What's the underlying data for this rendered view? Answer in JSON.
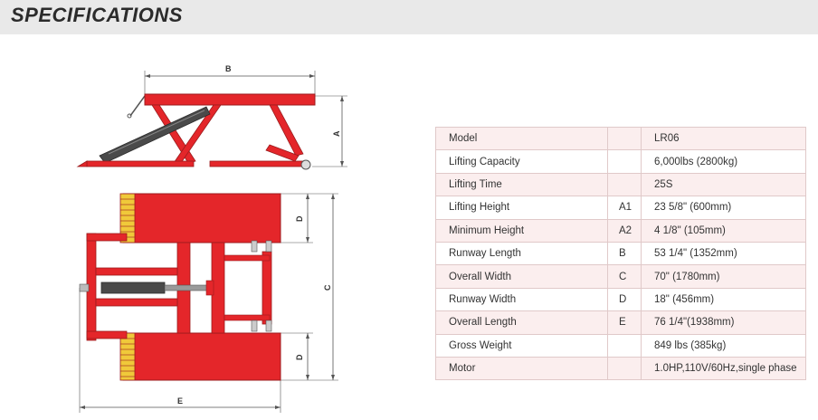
{
  "header": {
    "title": "SPECIFICATIONS"
  },
  "diagram": {
    "labels": {
      "b": "B",
      "a": "A",
      "d_top": "D",
      "c": "C",
      "d_bottom": "D",
      "e": "E"
    },
    "colors": {
      "body": "#e4262a",
      "outline": "#9b1b1d",
      "hydraulic": "#4a4a4a",
      "tread": "#f0c93a"
    }
  },
  "specs": [
    {
      "name": "Model",
      "code": "",
      "value": "LR06"
    },
    {
      "name": "Lifting Capacity",
      "code": "",
      "value": "6,000lbs (2800kg)"
    },
    {
      "name": "Lifting Time",
      "code": "",
      "value": "25S"
    },
    {
      "name": "Lifting Height",
      "code": "A1",
      "value": "23 5/8\" (600mm)"
    },
    {
      "name": "Minimum Height",
      "code": "A2",
      "value": "4 1/8\" (105mm)"
    },
    {
      "name": "Runway Length",
      "code": "B",
      "value": "53 1/4\" (1352mm)"
    },
    {
      "name": "Overall Width",
      "code": "C",
      "value": "70\" (1780mm)"
    },
    {
      "name": "Runway Width",
      "code": "D",
      "value": "18\" (456mm)"
    },
    {
      "name": "Overall Length",
      "code": "E",
      "value": "76 1/4\"(1938mm)"
    },
    {
      "name": "Gross Weight",
      "code": "",
      "value": "849 lbs (385kg)"
    },
    {
      "name": "Motor",
      "code": "",
      "value": "1.0HP,110V/60Hz,single phase"
    }
  ]
}
